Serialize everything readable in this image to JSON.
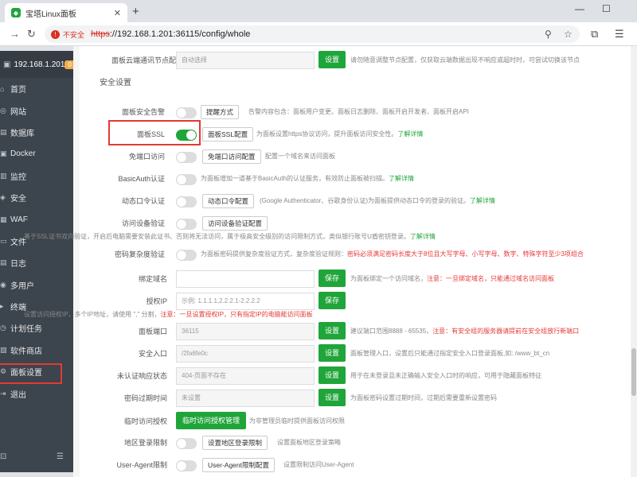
{
  "browser": {
    "tab_title": "宝塔Linux面板",
    "favicon_glyph": "◆",
    "tab_close": "✕",
    "new_tab": "+",
    "insecure_label": "不安全",
    "url_scheme": "https",
    "url_rest": "://192.168.1.201:36115/config/whole",
    "accent": "#20a53a"
  },
  "sidebar": {
    "server_ip": "192.168.1.201",
    "badge": "0",
    "items": [
      {
        "label": "首页",
        "icon": "home-icon"
      },
      {
        "label": "网站",
        "icon": "globe-icon"
      },
      {
        "label": "数据库",
        "icon": "database-icon"
      },
      {
        "label": "Docker",
        "icon": "docker-icon"
      },
      {
        "label": "监控",
        "icon": "monitor-icon"
      },
      {
        "label": "安全",
        "icon": "shield-icon"
      },
      {
        "label": "WAF",
        "icon": "firewall-icon"
      },
      {
        "label": "文件",
        "icon": "folder-icon"
      },
      {
        "label": "日志",
        "icon": "log-icon"
      },
      {
        "label": "多用户",
        "icon": "users-icon"
      },
      {
        "label": "终端",
        "icon": "terminal-icon"
      },
      {
        "label": "计划任务",
        "icon": "clock-icon"
      },
      {
        "label": "软件商店",
        "icon": "store-icon"
      },
      {
        "label": "面板设置",
        "icon": "settings-icon"
      },
      {
        "label": "退出",
        "icon": "logout-icon"
      }
    ],
    "active_index": 13
  },
  "content": {
    "top_row": {
      "label": "面板云端通讯节点配置",
      "value": "自动选择",
      "save": "设置",
      "desc": "请勿随意调整节点配置，仅获取云端数据出现不响应或超时时，可尝试切换该节点"
    },
    "section_title": "安全设置",
    "alert": {
      "label": "面板安全告警",
      "enabled": false,
      "button": "提醒方式",
      "desc": "告警内容包含：面板用户变更、面板日志删除、面板开启开发者、面板开启API"
    },
    "ssl": {
      "label": "面板SSL",
      "enabled": true,
      "button": "面板SSL配置",
      "desc": "为面板设置https协议访问，提升面板访问安全性。",
      "more": "了解详情"
    },
    "port_free": {
      "label": "免端口访问",
      "enabled": false,
      "button": "免端口访问配置",
      "desc": "配置一个域名来访问面板"
    },
    "basicauth": {
      "label": "BasicAuth认证",
      "enabled": false,
      "desc": "为面板增加一道基于BasicAuth的认证服务，有效防止面板被扫描。",
      "more": "了解详情"
    },
    "otp": {
      "label": "动态口令认证",
      "enabled": false,
      "button": "动态口令配置",
      "desc": "(Google Authenticator、谷歌身份认证)为面板提供动态口令的登录的验证。",
      "more": "了解详情"
    },
    "device": {
      "label": "访问设备验证",
      "enabled": false,
      "button": "访问设备验证配置"
    },
    "device_note": {
      "desc": "基于SSL证书双向验证，开启后电脑需要安装此证书、否则将无法访问，属于极高安全级别的访问限制方式，类似银行账号U盾密钥登录。",
      "more": "了解详情"
    },
    "password_complexity": {
      "label": "密码复杂度验证",
      "enabled": false,
      "desc": "为面板密码提供复杂度验证方式，复杂度验证规则：",
      "red": "密码必须满足密码长度大于8位且大写字母、小写字母、数字、特殊字符至少3项组合"
    },
    "bind_domain": {
      "label": "绑定域名",
      "value": "",
      "save": "保存",
      "desc": "为面板绑定一个访问域名，",
      "red": "注意：一旦绑定域名，只能通过域名访问面板"
    },
    "auth_ip": {
      "label": "授权IP",
      "placeholder": "示例: 1.1.1.1,2.2.2.1-2.2.2.2",
      "save": "保存"
    },
    "auth_ip_note": {
      "desc": "设置访问授权IP，多个IP地址，请使用 \",\" 分割，",
      "red": "注意：一旦设置授权IP，只有指定IP的电脑能访问面板"
    },
    "panel_port": {
      "label": "面板端口",
      "value": "36115",
      "save": "设置",
      "desc": "建议端口范围8888 - 65535，",
      "red": "注意：有安全组的服务器请提前在安全组放行新端口"
    },
    "security_entry": {
      "label": "安全入口",
      "value": "/2fa6fe0c",
      "save": "设置",
      "desc": "面板管理入口，设置后只能通过指定安全入口登录面板,如: /www_bt_cn"
    },
    "unauth_status": {
      "label": "未认证响应状态",
      "value": "404-页面不存在",
      "save": "设置",
      "desc": "用于在未登录且未正确输入安全入口时的响应，可用于隐藏面板特征"
    },
    "pwd_expire": {
      "label": "密码过期时间",
      "value": "未设置",
      "save": "设置",
      "desc": "为面板密码设置过期时间，过期后需要重新设置密码"
    },
    "temp_auth": {
      "label": "临时访问授权",
      "button": "临时访问授权管理",
      "desc": "为非管理员临时提供面板访问权限"
    },
    "region_limit": {
      "label": "地区登录限制",
      "enabled": false,
      "button": "设置地区登录限制",
      "desc": "设置面板地区登录策略"
    },
    "ua_limit": {
      "label": "User-Agent限制",
      "enabled": false,
      "button": "User-Agent限制配置",
      "desc": "设置限制访问User-Agent"
    }
  }
}
